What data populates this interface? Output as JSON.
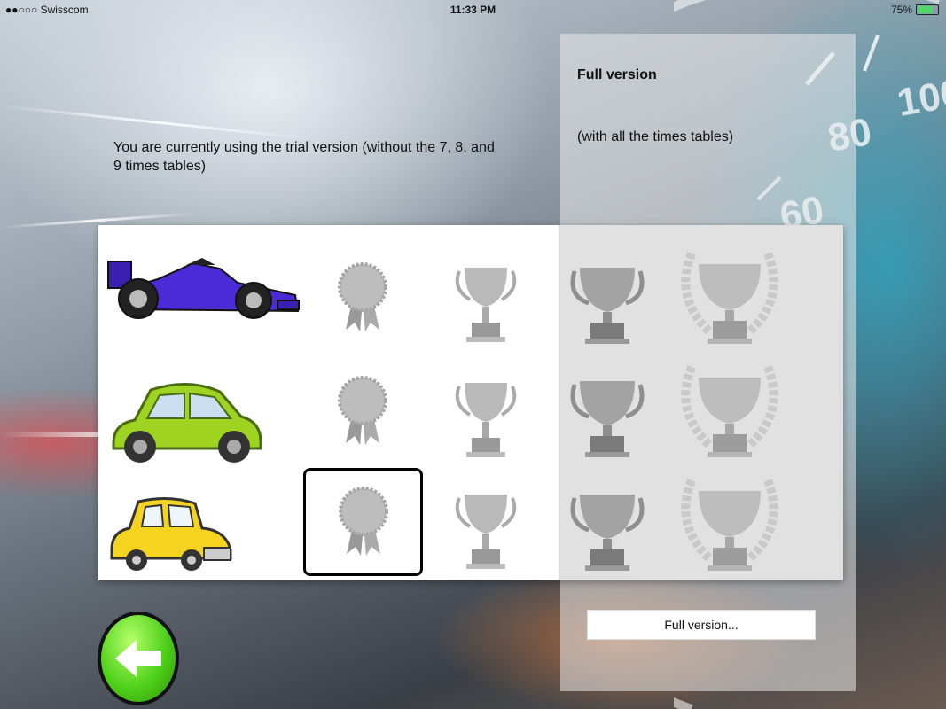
{
  "status_bar": {
    "carrier": "●●○○○ Swisscom",
    "time": "11:33 PM",
    "battery": "75%"
  },
  "trial": {
    "message": "You are currently using the trial version (without the 7, 8, and 9 times tables)"
  },
  "full_version": {
    "title": "Full version",
    "subtitle": "(with all the times tables)",
    "button_label": "Full version..."
  },
  "speedometer": {
    "labels": [
      "100",
      "80",
      "60"
    ]
  },
  "rows": [
    {
      "vehicle": "formula-one-car",
      "selected_column": null
    },
    {
      "vehicle": "green-beetle-car",
      "selected_column": null
    },
    {
      "vehicle": "yellow-cartoon-car",
      "selected_column": "medal"
    }
  ],
  "colors": {
    "back_button": "#4fd11a",
    "f1_car": "#4b2bd6",
    "beetle_car": "#9ed321",
    "cartoon_car": "#f5d421"
  }
}
